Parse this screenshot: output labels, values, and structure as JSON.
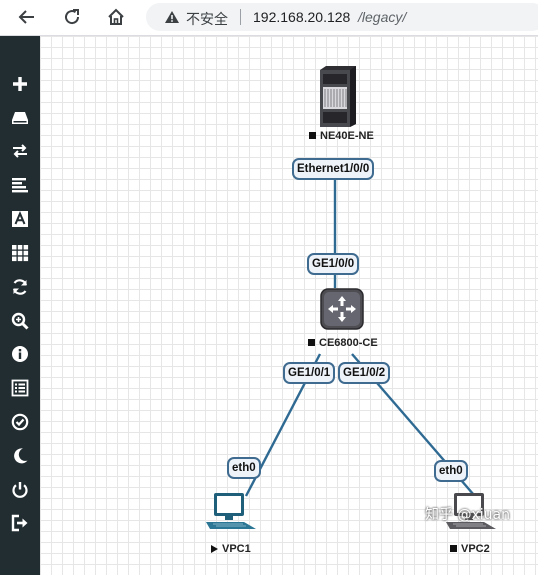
{
  "browser": {
    "insecure_label": "不安全",
    "url_host": "192.168.20.128",
    "url_path": "/legacy/"
  },
  "sidebar": {
    "items": [
      {
        "name": "add",
        "icon": "plus-icon"
      },
      {
        "name": "nodes",
        "icon": "hdd-icon"
      },
      {
        "name": "networks",
        "icon": "exchange-icon"
      },
      {
        "name": "startup-configs",
        "icon": "align-left-icon"
      },
      {
        "name": "text",
        "icon": "text-icon"
      },
      {
        "name": "more-actions",
        "icon": "grid-icon"
      },
      {
        "name": "refresh",
        "icon": "refresh-icon"
      },
      {
        "name": "zoom",
        "icon": "zoom-icon"
      },
      {
        "name": "status",
        "icon": "info-icon"
      },
      {
        "name": "lab-list",
        "icon": "list-icon"
      },
      {
        "name": "lock-lab",
        "icon": "check-circle-icon"
      },
      {
        "name": "dark-mode",
        "icon": "moon-icon"
      },
      {
        "name": "close-lab",
        "icon": "power-icon"
      },
      {
        "name": "logout",
        "icon": "sign-out-icon"
      }
    ]
  },
  "topology": {
    "nodes": {
      "ne40e": {
        "label": "NE40E-NE",
        "state": "stopped"
      },
      "ce6800": {
        "label": "CE6800-CE",
        "state": "stopped"
      },
      "vpc1": {
        "label": "VPC1",
        "state": "running"
      },
      "vpc2": {
        "label": "VPC2",
        "state": "stopped"
      }
    },
    "ports": {
      "ne40e_if": "Ethernet1/0/0",
      "ce_up": "GE1/0/0",
      "ce_left": "GE1/0/1",
      "ce_right": "GE1/0/2",
      "vpc1_if": "eth0",
      "vpc2_if": "eth0"
    },
    "link_color": "#2f6a93"
  },
  "watermark": "知乎 @xiuan"
}
